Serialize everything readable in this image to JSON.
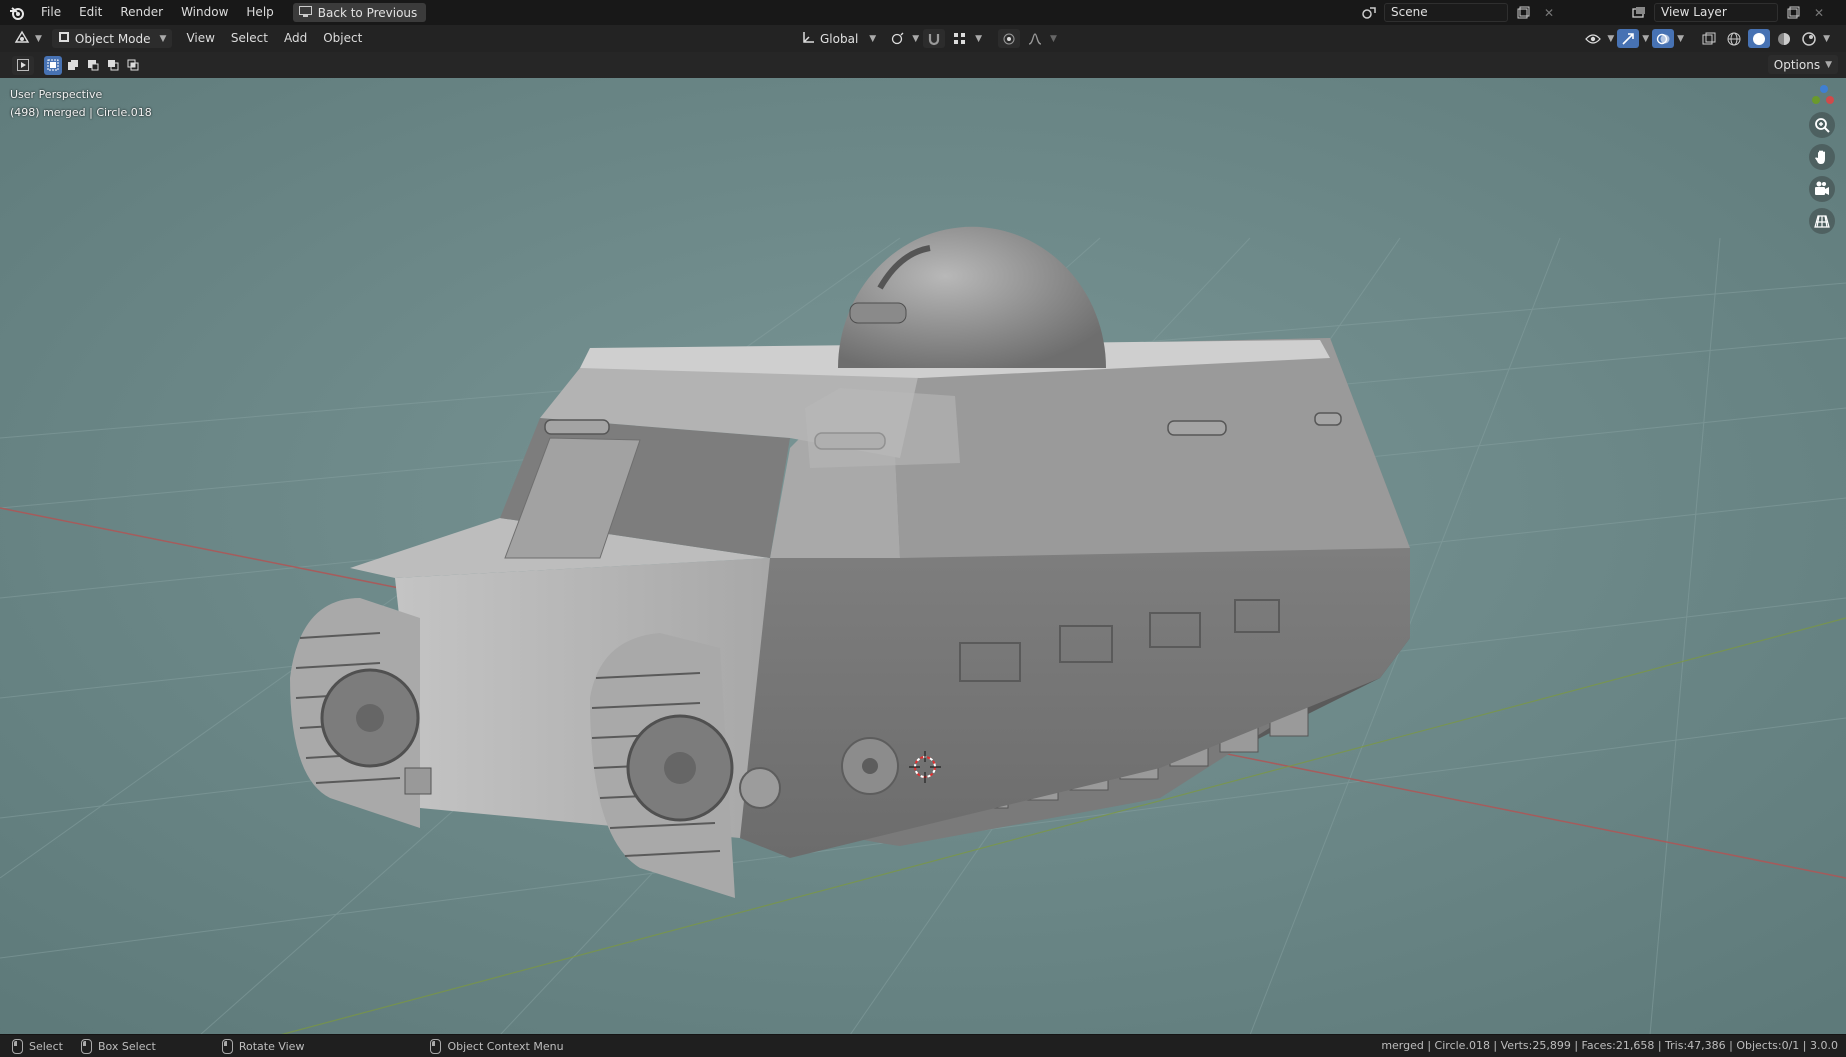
{
  "topbar": {
    "menus": [
      "File",
      "Edit",
      "Render",
      "Window",
      "Help"
    ],
    "back_button": "Back to Previous",
    "scene": "Scene",
    "view_layer": "View Layer"
  },
  "header": {
    "mode": "Object Mode",
    "menus": [
      "View",
      "Select",
      "Add",
      "Object"
    ],
    "orientation": "Global"
  },
  "toolrow": {
    "options": "Options"
  },
  "viewport": {
    "perspective": "User Perspective",
    "object_info": "(498) merged | Circle.018",
    "background": "#6e8a8a"
  },
  "statusbar": {
    "select": "Select",
    "box_select": "Box Select",
    "rotate_view": "Rotate View",
    "context_menu": "Object Context Menu",
    "stats": "merged | Circle.018 | Verts:25,899 | Faces:21,658 | Tris:47,386 | Objects:0/1 | 3.0.0"
  },
  "colors": {
    "accent": "#4772b3",
    "x_axis": "#b05555",
    "y_axis": "#7d9a3c"
  }
}
